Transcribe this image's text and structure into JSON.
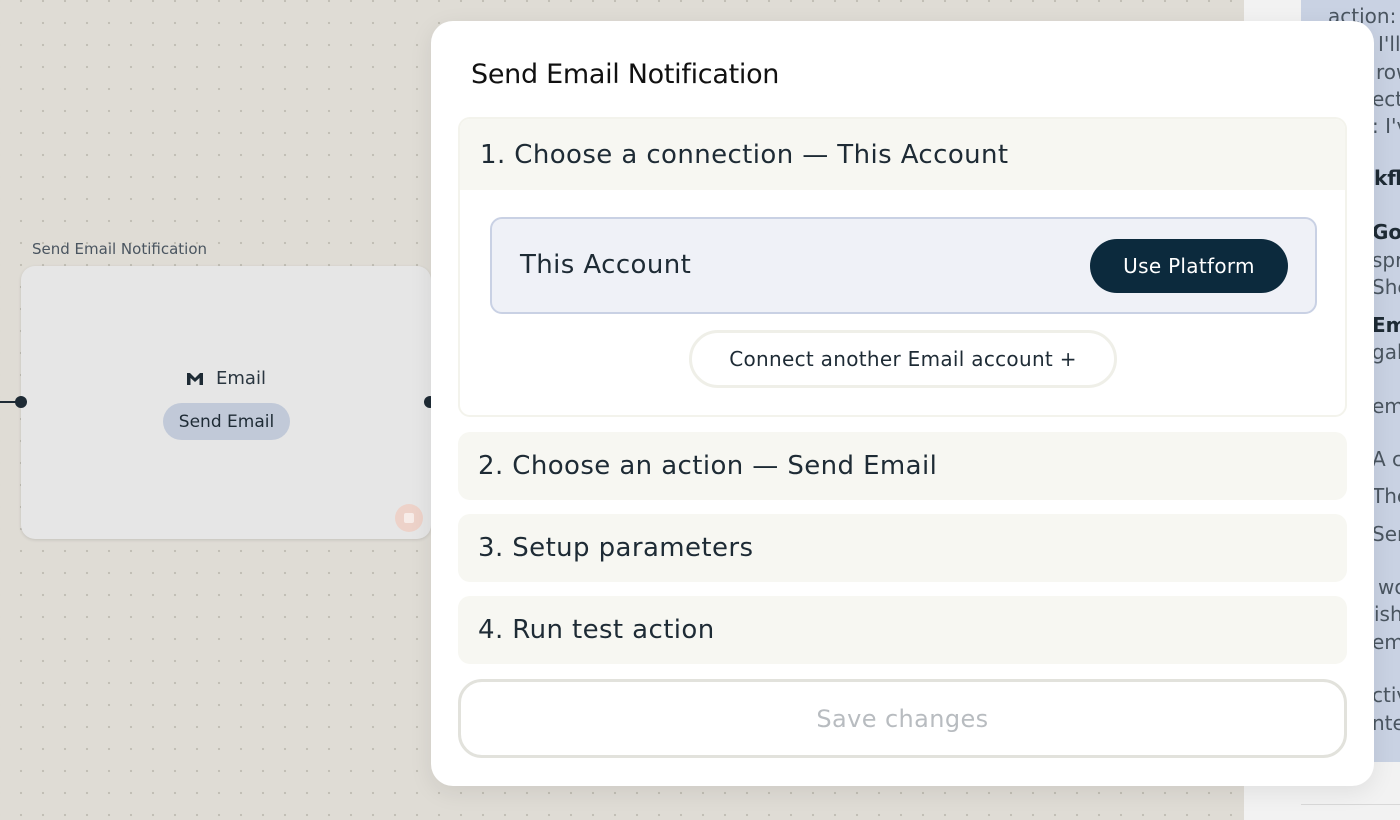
{
  "canvas": {
    "node": {
      "label": "Send Email Notification",
      "app_icon": "gmail-icon",
      "app_name": "Email",
      "action_chip": "Send Email"
    }
  },
  "doc_panel": {
    "fragments": [
      {
        "text": "action:",
        "bold": false
      },
      {
        "text": "I'll",
        "bold": false
      },
      {
        "text": "row",
        "bold": false
      },
      {
        "text": "ect",
        "bold": false
      },
      {
        "text": ": I'v",
        "bold": false
      },
      {
        "text": "kflo",
        "bold": true
      },
      {
        "text": "Goo",
        "bold": true
      },
      {
        "text": "spr",
        "bold": false
      },
      {
        "text": "She",
        "bold": false
      },
      {
        "text": "Em",
        "bold": true
      },
      {
        "text": "gab",
        "bold": false
      },
      {
        "text": "em",
        "bold": false
      },
      {
        "text": "A c",
        "bold": false
      },
      {
        "text": "The",
        "bold": false
      },
      {
        "text": "Ser",
        "bold": false
      },
      {
        "text": "wo",
        "bold": false
      },
      {
        "text": "ish",
        "bold": false
      },
      {
        "text": "em",
        "bold": false
      },
      {
        "text": "ctiv",
        "bold": false
      },
      {
        "text": "nte",
        "bold": false
      }
    ]
  },
  "modal": {
    "title": "Send Email Notification",
    "steps": [
      {
        "label": "1. Choose a connection — This Account",
        "expanded": true
      },
      {
        "label": "2. Choose an action — Send Email",
        "expanded": false
      },
      {
        "label": "3. Setup parameters",
        "expanded": false
      },
      {
        "label": "4. Run test action",
        "expanded": false
      }
    ],
    "connection": {
      "selected_name": "This Account",
      "use_platform_label": "Use Platform",
      "connect_another_label": "Connect another Email account +"
    },
    "save_label": "Save changes"
  },
  "colors": {
    "primary_button": "#0c2a3d",
    "connection_box": "#eff1f7",
    "step_background": "#f7f7f2",
    "node_chip": "#c1c9d8"
  }
}
